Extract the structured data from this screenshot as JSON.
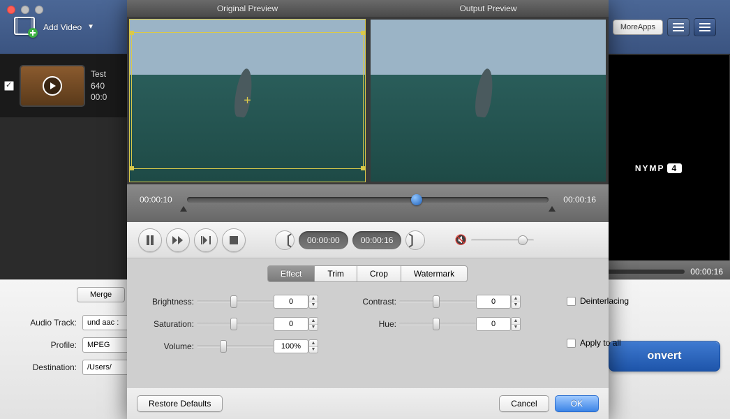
{
  "main": {
    "add_video": "Add Video",
    "more_apps": "MoreApps",
    "video": {
      "name": "Test",
      "dims": "640",
      "time": "00:0"
    },
    "brand_text": "NYMP",
    "brand_num": "4",
    "preview_time": "00:00:16",
    "merge": "Merge",
    "audio_track_label": "Audio Track:",
    "audio_track_value": "und aac :",
    "profile_label": "Profile:",
    "profile_value": "MPEG",
    "destination_label": "Destination:",
    "destination_value": "/Users/",
    "convert": "onvert"
  },
  "dialog": {
    "header": {
      "left": "Original Preview",
      "right": "Output Preview"
    },
    "timeline": {
      "pos": "00:00:10",
      "dur": "00:00:16"
    },
    "clip": {
      "in": "00:00:00",
      "out": "00:00:16"
    },
    "tabs": [
      "Effect",
      "Trim",
      "Crop",
      "Watermark"
    ],
    "effect": {
      "brightness_label": "Brightness:",
      "brightness": "0",
      "contrast_label": "Contrast:",
      "contrast": "0",
      "saturation_label": "Saturation:",
      "saturation": "0",
      "hue_label": "Hue:",
      "hue": "0",
      "volume_label": "Volume:",
      "volume": "100%",
      "deinterlacing": "Deinterlacing",
      "apply_all": "Apply to all"
    },
    "footer": {
      "restore": "Restore Defaults",
      "cancel": "Cancel",
      "ok": "OK"
    }
  }
}
